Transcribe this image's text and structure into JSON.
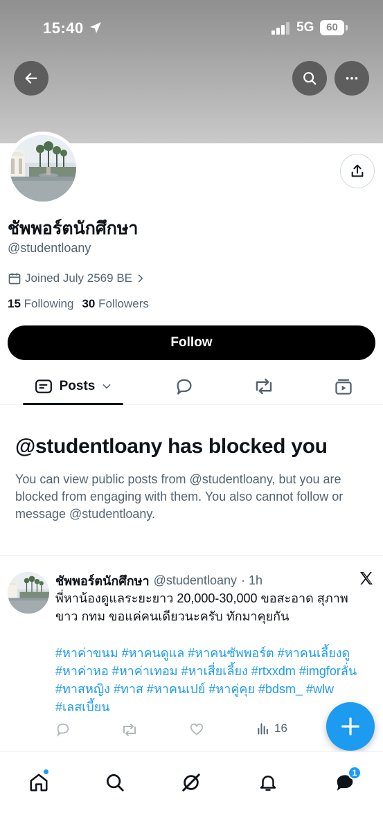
{
  "status_bar": {
    "time": "15:40",
    "network": "5G",
    "battery": "60"
  },
  "profile": {
    "display_name": "ชัพพอร์ตนักศึกษา",
    "handle": "@studentloany",
    "joined": "Joined July 2569 BE",
    "following_count": "15",
    "following_label": "Following",
    "followers_count": "30",
    "followers_label": "Followers",
    "follow_button": "Follow"
  },
  "tabs": [
    {
      "label": "Posts",
      "icon": "posts-icon",
      "active": true
    },
    {
      "label": "",
      "icon": "replies-icon"
    },
    {
      "label": "",
      "icon": "reposts-icon"
    },
    {
      "label": "",
      "icon": "media-icon"
    }
  ],
  "blocked": {
    "title": "@studentloany has blocked you",
    "body": "You can view public posts from @studentloany, but you are blocked from engaging with them. You also cannot follow or message @studentloany."
  },
  "tweet": {
    "name": "ชัพพอร์ตนักศึกษา",
    "handle": "@studentloany",
    "time": "· 1h",
    "text": "พี่หาน้องดูแลระยะยาว 20,000-30,000 ขอสะอาด สุภาพ ขาว กทม ขอแค่คนเดียวนะครับ ทักมาคุยกัน",
    "tags": "#หาค่าขนม #หาคนดูแล #หาคนซัพพอร์ต #หาคนเลี้ยงดู #หาค่าหอ  #หาค่าเทอม #หาเสี่ยเลี้ยง #rtxxdm #imgforลั่น #ทาสหญิง #ทาส #หาคนเปย์ #หาคู่คุย #bdsm_ #wlw #เลสเบี้ยน",
    "views": "16"
  },
  "bottom_nav": {
    "messages_badge": "1"
  },
  "colors": {
    "accent": "#1d9bf0",
    "text": "#0f1419",
    "muted": "#536471"
  }
}
